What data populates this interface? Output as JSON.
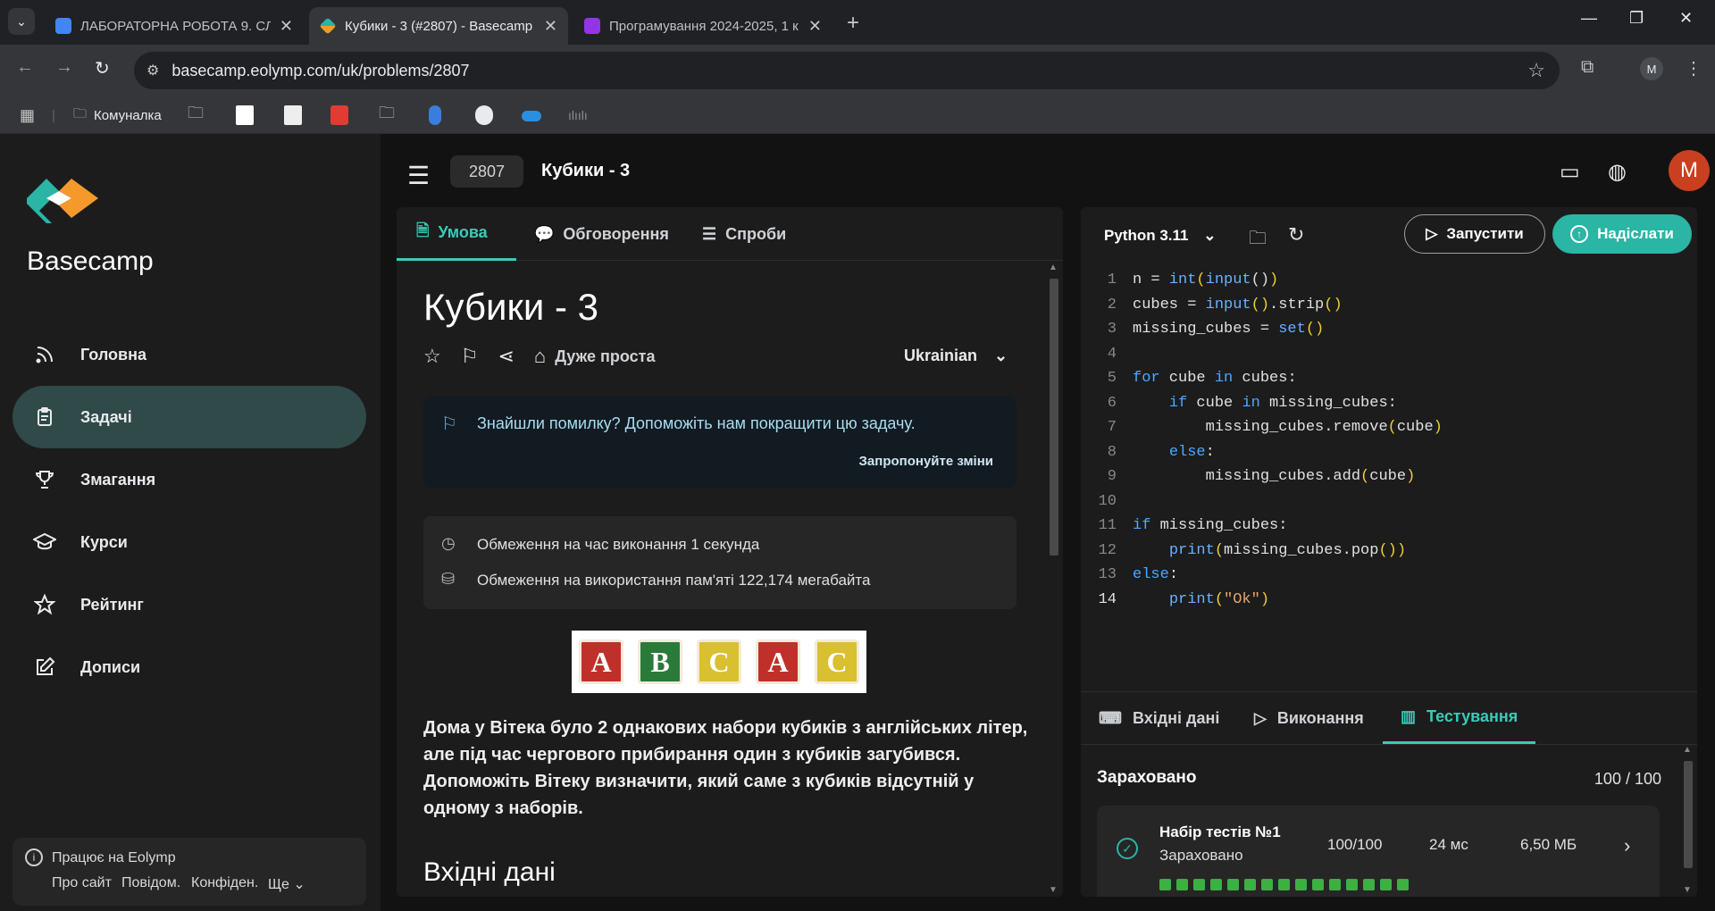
{
  "browser": {
    "tabs": [
      {
        "title": "ЛАБОРАТОРНА РОБОТА 9. СЛ",
        "color": "#4285f4"
      },
      {
        "title": "Кубики - 3 (#2807) - Basecamp",
        "color": "#2ab5a5"
      },
      {
        "title": "Програмування 2024-2025, 1 к",
        "color": "#9334e6"
      }
    ],
    "url": "basecamp.eolymp.com/uk/problems/2807",
    "profile_letter": "M",
    "bookmarks": [
      {
        "label": "Комуналка"
      }
    ]
  },
  "sidebar": {
    "brand": "Basecamp",
    "items": [
      {
        "label": "Головна",
        "icon": "rss-icon"
      },
      {
        "label": "Задачі",
        "icon": "clipboard-icon",
        "selected": true
      },
      {
        "label": "Змагання",
        "icon": "trophy-icon"
      },
      {
        "label": "Курси",
        "icon": "graduation-cap-icon"
      },
      {
        "label": "Рейтинг",
        "icon": "star-icon"
      },
      {
        "label": "Дописи",
        "icon": "edit-icon"
      }
    ],
    "footer": {
      "title": "Працює на Eolymp",
      "links": [
        "Про сайт",
        "Повідом.",
        "Конфіден.",
        "Ще"
      ]
    }
  },
  "header": {
    "problem_id": "2807",
    "problem_title": "Кубики - 3",
    "avatar_letter": "M"
  },
  "problem": {
    "tabs": [
      "Умова",
      "Обговорення",
      "Спроби"
    ],
    "title": "Кубики - 3",
    "difficulty": "Дуже проста",
    "language": "Ukrainian",
    "hint_text": "Знайшли помилку? Допоможіть нам покращити цю задачу.",
    "hint_action": "Запропонуйте зміни",
    "time_limit": "Обмеження на час виконання 1 секунда",
    "memory_limit": "Обмеження на використання пам'яті 122,174 мегабайта",
    "cubes": [
      {
        "letter": "A",
        "color": "#c0302a"
      },
      {
        "letter": "B",
        "color": "#2a7a3a"
      },
      {
        "letter": "C",
        "color": "#d8c030"
      },
      {
        "letter": "A",
        "color": "#c0302a"
      },
      {
        "letter": "C",
        "color": "#d8c030"
      }
    ],
    "description": "Дома у Вітека було 2 однакових набори кубиків з англійських літер, але під час чергового прибирання один з кубиків загубився. Допоможіть Вітеку визначити, який саме з кубиків відсутній у одному з наборів.",
    "section_input": "Вхідні дані"
  },
  "editor": {
    "language": "Python 3.11",
    "run_label": "Запустити",
    "submit_label": "Надіслати",
    "lines": [
      "n = int(input())",
      "cubes = input().strip()",
      "missing_cubes = set()",
      "",
      "for cube in cubes:",
      "    if cube in missing_cubes:",
      "        missing_cubes.remove(cube)",
      "    else:",
      "        missing_cubes.add(cube)",
      "",
      "if missing_cubes:",
      "    print(missing_cubes.pop())",
      "else:",
      "    print(\"Ok\")"
    ],
    "current_line": 14
  },
  "results": {
    "tabs": [
      "Вхідні дані",
      "Виконання",
      "Тестування"
    ],
    "status": "Зараховано",
    "score": "100 / 100",
    "test_set": {
      "name": "Набір тестів №1",
      "status": "Зараховано",
      "score": "100/100",
      "time": "24 мс",
      "memory": "6,50 МБ",
      "passed_tests": 15
    }
  }
}
